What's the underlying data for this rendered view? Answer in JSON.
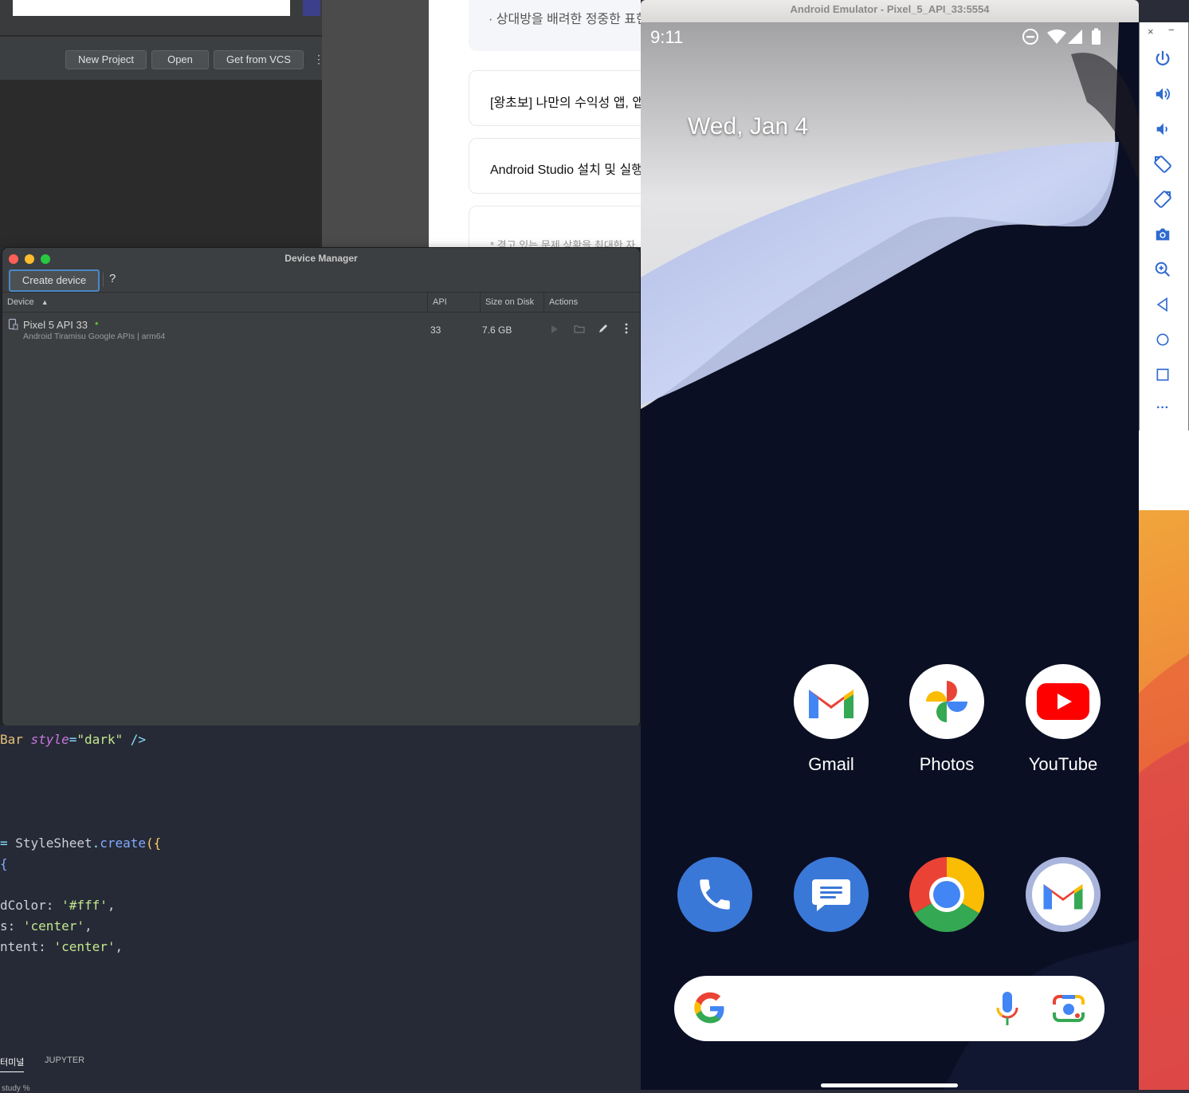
{
  "android_studio": {
    "buttons": [
      "New Project",
      "Open",
      "Get from VCS"
    ],
    "more_icon": "⋮"
  },
  "web": {
    "line1": "· 상대방을 배려한 정중한 표현",
    "cards": [
      "[왕초보] 나만의 수익성 앱, 앱",
      "Android Studio 설치 및 실행"
    ],
    "footnote": "* 경고 있는 문제 상황을 최대한 자"
  },
  "device_manager": {
    "title": "Device Manager",
    "create_label": "Create device",
    "help_label": "?",
    "columns": {
      "device": "Device",
      "sort_arrow": "▲",
      "api": "API",
      "size": "Size on Disk",
      "actions": "Actions"
    },
    "devices": [
      {
        "name": "Pixel 5 API 33",
        "status_dot": "•",
        "sub": "Android Tiramisu Google APIs | arm64",
        "api": "33",
        "size": "7.6 GB"
      }
    ]
  },
  "code": {
    "lines": [
      {
        "p1": "Bar ",
        "p2": "style",
        "p3": "=",
        "p4": "\"dark\"",
        "p5": " />"
      },
      {
        "a": "= ",
        "b": "StyleSheet",
        "c": ".",
        "d": "create",
        "e": "({"
      },
      {
        "t": "{"
      },
      {
        "k": "dColor: ",
        "v": "'#fff'",
        "e": ","
      },
      {
        "k": "s: ",
        "v": "'center'",
        "e": ","
      },
      {
        "k": "ntent: ",
        "v": "'center'",
        "e": ","
      }
    ],
    "tabs": [
      "터미널",
      "JUPYTER"
    ],
    "prompt": "study %"
  },
  "emulator": {
    "title": "Android Emulator - Pixel_5_API_33:5554",
    "time": "9:11",
    "date": "Wed, Jan 4",
    "apps": [
      "Gmail",
      "Photos",
      "YouTube"
    ],
    "dock": [
      "phone",
      "messages",
      "chrome",
      "gmail"
    ],
    "panel_close": "×",
    "panel_min": "−",
    "more": "···"
  },
  "colors": {
    "accent": "#4a88c7",
    "online": "#5fb832",
    "youtube": "#ff0000",
    "phone_bg": "#0b0f23"
  }
}
